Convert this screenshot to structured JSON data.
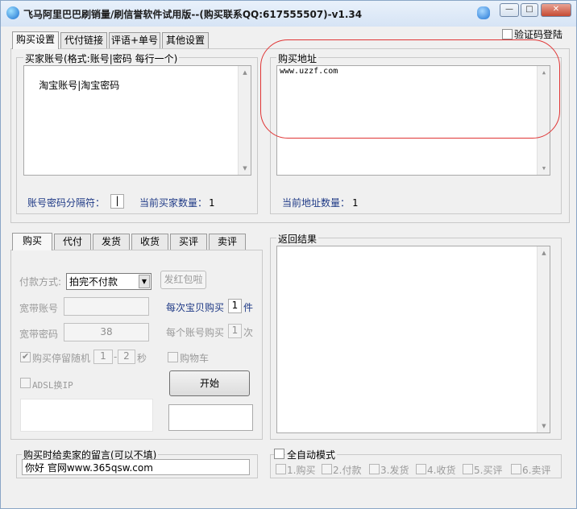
{
  "window": {
    "title": "飞马阿里巴巴刷销量/刷信誉软件试用版--(购买联系QQ:617555507)-v1.34",
    "minimize": "—",
    "maximize": "□",
    "close": "✕"
  },
  "top_tabs": [
    {
      "label": "购买设置",
      "active": true
    },
    {
      "label": "代付链接",
      "active": false
    },
    {
      "label": "评语+单号",
      "active": false
    },
    {
      "label": "其他设置",
      "active": false
    }
  ],
  "captcha_login": {
    "label": "验证码登陆",
    "checked": false
  },
  "buyer_accounts": {
    "title": "买家账号(格式:账号|密码 每行一个)",
    "content": "淘宝账号|淘宝密码",
    "separator_label": "账号密码分隔符：",
    "separator_value": "|",
    "count_label": "当前买家数量：",
    "count_value": "1"
  },
  "buy_address": {
    "title": "购买地址",
    "content": "www.uzzf.com",
    "count_label": "当前地址数量：",
    "count_value": "1"
  },
  "bottom_tabs": [
    {
      "label": "购买",
      "active": true
    },
    {
      "label": "代付",
      "active": false
    },
    {
      "label": "发货",
      "active": false
    },
    {
      "label": "收货",
      "active": false
    },
    {
      "label": "买评",
      "active": false
    },
    {
      "label": "卖评",
      "active": false
    }
  ],
  "purchase": {
    "payment_label": "付款方式:",
    "payment_value": "拍完不付款",
    "red_packet_button": "发红包啦",
    "broadband_account_label": "宽带账号",
    "broadband_account_value": "",
    "broadband_password_label": "宽带密码",
    "broadband_password_value": "38",
    "per_item_label": "每次宝贝购买",
    "per_item_value": "1",
    "per_item_unit": "件",
    "per_account_label": "每个账号购买",
    "per_account_value": "1",
    "per_account_unit": "次",
    "random_pause_label": "购买停留随机",
    "random_pause_checked": true,
    "pause_min": "1",
    "pause_sep": "-",
    "pause_max": "2",
    "pause_unit": "秒",
    "cart_label": "购物车",
    "cart_checked": false,
    "adsl_label": "ADSL换IP",
    "adsl_checked": false,
    "start_button": "开始"
  },
  "return_result": {
    "title": "返回结果",
    "content": ""
  },
  "seller_message": {
    "title": "购买时给卖家的留言(可以不填)",
    "value": "你好  官网www.365qsw.com"
  },
  "auto_mode": {
    "label": "全自动模式",
    "checked": false,
    "steps": [
      "1.购买",
      "2.付款",
      "3.发货",
      "4.收货",
      "5.买评",
      "6.卖评"
    ]
  }
}
